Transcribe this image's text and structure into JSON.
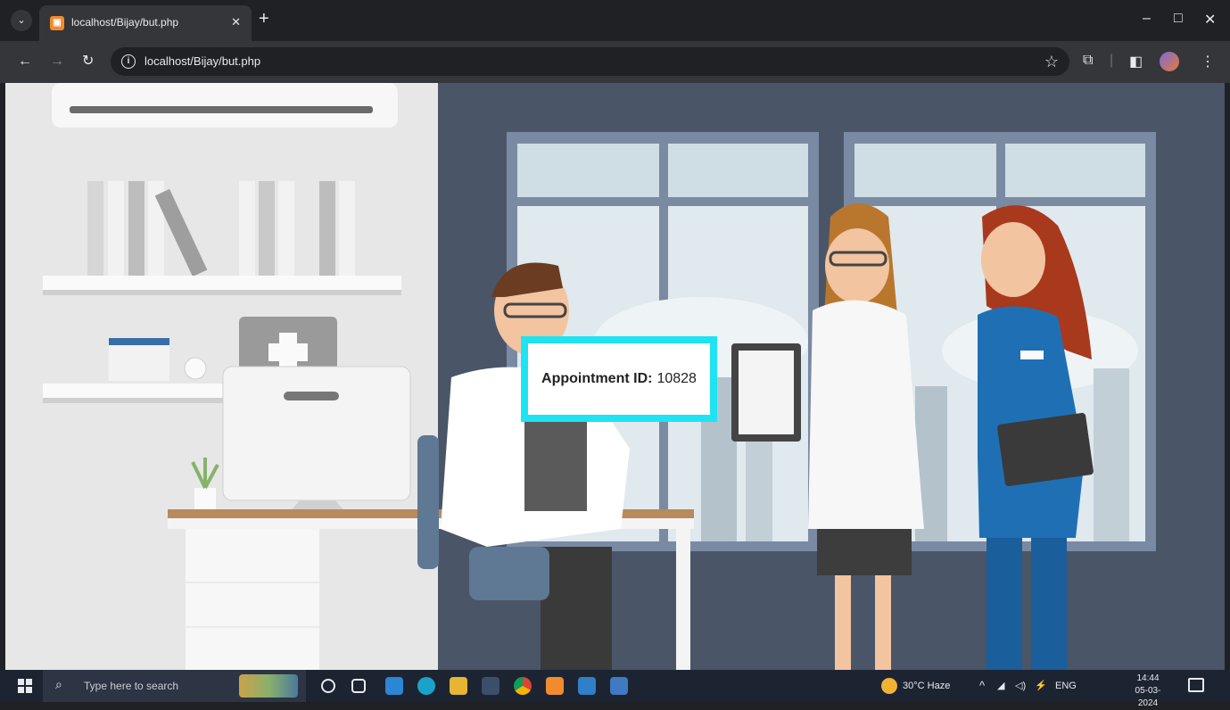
{
  "browser": {
    "tab_title": "localhost/Bijay/but.php",
    "address": "localhost/Bijay/but.php",
    "new_tab": "+",
    "minimize": "–",
    "maximize": "□",
    "close": "✕",
    "back": "←",
    "forward": "→",
    "reload": "↻"
  },
  "page": {
    "card_label": "Appointment ID:",
    "appointment_id": "10828"
  },
  "taskbar": {
    "search_placeholder": "Type here to search",
    "weather": "30°C  Haze",
    "language": "ENG",
    "time": "14:44",
    "date": "05-03-2024"
  },
  "colors": {
    "card_border": "#1fe3f3",
    "wall_left": "#e7e7e7",
    "wall_right": "#4a5568",
    "taskbar": "#1c2432"
  },
  "icons": [
    "tab-search-icon",
    "favicon-icon",
    "close-tab-icon",
    "new-tab-icon",
    "back-icon",
    "forward-icon",
    "reload-icon",
    "site-info-icon",
    "bookmark-star-icon",
    "extensions-icon",
    "side-panel-icon",
    "profile-icon",
    "menu-icon",
    "windows-start-icon",
    "search-icon",
    "cortana-icon",
    "task-view-icon",
    "mail-icon",
    "edge-icon",
    "file-explorer-icon",
    "store-icon",
    "chrome-icon",
    "xampp-icon",
    "vscode-icon",
    "photos-icon",
    "weather-icon",
    "chevron-up-icon",
    "network-icon",
    "volume-icon",
    "notification-icon"
  ]
}
